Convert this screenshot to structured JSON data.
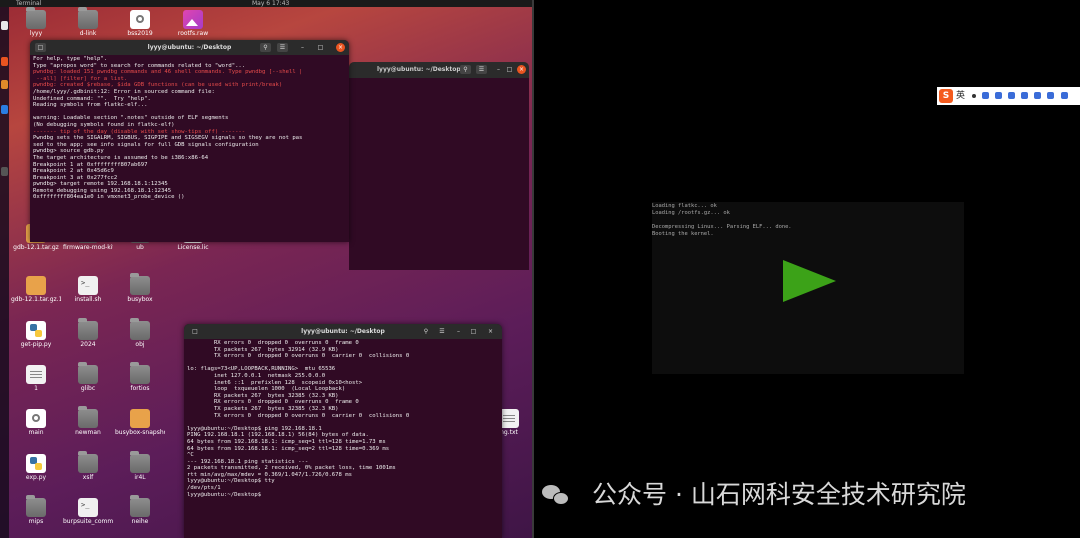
{
  "topbar": {
    "activities": "Terminal",
    "clock": "May 6 17:43"
  },
  "desktop_icons": [
    {
      "label": "lyyy",
      "kind": "home"
    },
    {
      "label": "d-link",
      "kind": "folder"
    },
    {
      "label": "bss2019",
      "kind": "gear"
    },
    {
      "label": "rootfs.raw",
      "kind": "image"
    },
    {
      "label": "gdb-12.1.tar.gz",
      "kind": "archive"
    },
    {
      "label": "firmware-mod-kit",
      "kind": "folder"
    },
    {
      "label": "ub",
      "kind": "folder"
    },
    {
      "label": "License.lic",
      "kind": "doc"
    },
    {
      "label": "gdb-12.1.tar.gz.1",
      "kind": "archive"
    },
    {
      "label": "install.sh",
      "kind": "script"
    },
    {
      "label": "busybox",
      "kind": "folder"
    },
    {
      "label": "get-pip.py",
      "kind": "python"
    },
    {
      "label": "2024",
      "kind": "folder"
    },
    {
      "label": "obj",
      "kind": "folder"
    },
    {
      "label": "1",
      "kind": "doc"
    },
    {
      "label": "glibc",
      "kind": "folder"
    },
    {
      "label": "fortios",
      "kind": "folder"
    },
    {
      "label": "main",
      "kind": "gear"
    },
    {
      "label": "newman",
      "kind": "folder"
    },
    {
      "label": "busybox-snapshot.tar...",
      "kind": "archive"
    },
    {
      "label": "exp.py",
      "kind": "python"
    },
    {
      "label": "xslf",
      "kind": "folder"
    },
    {
      "label": "ir4L",
      "kind": "folder"
    },
    {
      "label": "mips",
      "kind": "folder"
    },
    {
      "label": "burpsuite_community_linux_...",
      "kind": "script"
    },
    {
      "label": "neihe",
      "kind": "folder"
    },
    {
      "label": "ng.txt",
      "kind": "doc"
    }
  ],
  "terminal_gdb": {
    "title": "lyyy@ubuntu: ~/Desktop",
    "lines": [
      {
        "t": "For help, type \"help\".",
        "c": ""
      },
      {
        "t": "Type \"apropos word\" to search for commands related to \"word\"...",
        "c": ""
      },
      {
        "t": "pwndbg: loaded 151 pwndbg commands and 46 shell commands. Type pwndbg [--shell |",
        "c": "red"
      },
      {
        "t": " --all] [filter] for a list.",
        "c": "red"
      },
      {
        "t": "pwndbg: created $rebase, $ida GDB functions (can be used with print/break)",
        "c": "red"
      },
      {
        "t": "/home/lyyy/.gdbinit:12: Error in sourced command file:",
        "c": ""
      },
      {
        "t": "Undefined command: \"\".  Try \"help\".",
        "c": ""
      },
      {
        "t": "Reading symbols from flatkc-elf...",
        "c": ""
      },
      {
        "t": "",
        "c": ""
      },
      {
        "t": "warning: Loadable section \".notes\" outside of ELF segments",
        "c": ""
      },
      {
        "t": "(No debugging symbols found in flatkc-elf)",
        "c": ""
      },
      {
        "t": "------- tip of the day (disable with set show-tips off) -------",
        "c": "red"
      },
      {
        "t": "Pwndbg sets the SIGALRM, SIGBUS, SIGPIPE and SIGSEGV signals so they are not pas",
        "c": ""
      },
      {
        "t": "sed to the app; see info signals for full GDB signals configuration",
        "c": ""
      },
      {
        "t": "pwndbg> source gdb.py",
        "c": ""
      },
      {
        "t": "The target architecture is assumed to be i386:x86-64",
        "c": ""
      },
      {
        "t": "Breakpoint 1 at 0xffffffff807ab697",
        "c": ""
      },
      {
        "t": "Breakpoint 2 at 0x45d6c9",
        "c": ""
      },
      {
        "t": "Breakpoint 3 at 0x277fcc2",
        "c": ""
      },
      {
        "t": "pwndbg> target remote 192.168.18.1:12345",
        "c": ""
      },
      {
        "t": "Remote debugging using 192.168.18.1:12345",
        "c": ""
      },
      {
        "t": "0xffffffff804ea1e0 in vmxnet3_probe_device ()",
        "c": ""
      },
      {
        "t": "",
        "c": ""
      }
    ]
  },
  "terminal_bg": {
    "title": "lyyy@ubuntu: ~/Desktop"
  },
  "terminal_ping": {
    "title": "lyyy@ubuntu: ~/Desktop",
    "lines": [
      {
        "t": "        RX errors 0  dropped 0  overruns 0  frame 0",
        "c": ""
      },
      {
        "t": "        TX packets 267  bytes 32914 (32.9 KB)",
        "c": ""
      },
      {
        "t": "        TX errors 0  dropped 0 overruns 0  carrier 0  collisions 0",
        "c": ""
      },
      {
        "t": "",
        "c": ""
      },
      {
        "t": "lo: flags=73<UP,LOOPBACK,RUNNING>  mtu 65536",
        "c": ""
      },
      {
        "t": "        inet 127.0.0.1  netmask 255.0.0.0",
        "c": ""
      },
      {
        "t": "        inet6 ::1  prefixlen 128  scopeid 0x10<host>",
        "c": ""
      },
      {
        "t": "        loop  txqueuelen 1000  (Local Loopback)",
        "c": ""
      },
      {
        "t": "        RX packets 267  bytes 32385 (32.3 KB)",
        "c": ""
      },
      {
        "t": "        RX errors 0  dropped 0  overruns 0  frame 0",
        "c": ""
      },
      {
        "t": "        TX packets 267  bytes 32385 (32.3 KB)",
        "c": ""
      },
      {
        "t": "        TX errors 0  dropped 0 overruns 0  carrier 0  collisions 0",
        "c": ""
      },
      {
        "t": "",
        "c": ""
      },
      {
        "t": "lyyy@ubuntu:~/Desktop$ ping 192.168.18.1",
        "c": ""
      },
      {
        "t": "PING 192.168.18.1 (192.168.18.1) 56(84) bytes of data.",
        "c": ""
      },
      {
        "t": "64 bytes from 192.168.18.1: icmp_seq=1 ttl=128 time=1.73 ms",
        "c": ""
      },
      {
        "t": "64 bytes from 192.168.18.1: icmp_seq=2 ttl=128 time=0.369 ms",
        "c": ""
      },
      {
        "t": "^C",
        "c": ""
      },
      {
        "t": "--- 192.168.18.1 ping statistics ---",
        "c": ""
      },
      {
        "t": "2 packets transmitted, 2 received, 0% packet loss, time 1001ms",
        "c": ""
      },
      {
        "t": "rtt min/avg/max/mdev = 0.369/1.047/1.726/0.678 ms",
        "c": ""
      },
      {
        "t": "lyyy@ubuntu:~/Desktop$ tty",
        "c": ""
      },
      {
        "t": "/dev/pts/1",
        "c": ""
      },
      {
        "t": "lyyy@ubuntu:~/Desktop$ ",
        "c": ""
      }
    ]
  },
  "vm_console": {
    "lines": [
      "Loading flatkc... ok",
      "Loading /rootfs.gz... ok",
      "",
      "Decompressing Linux... Parsing ELF... done.",
      "Booting the kernel."
    ],
    "play_color": "#3ca218"
  },
  "ime_toolbar": {
    "logo": "S",
    "lang": "英"
  },
  "watermark": {
    "text": "公众号 · 山石网科安全技术研究院"
  }
}
